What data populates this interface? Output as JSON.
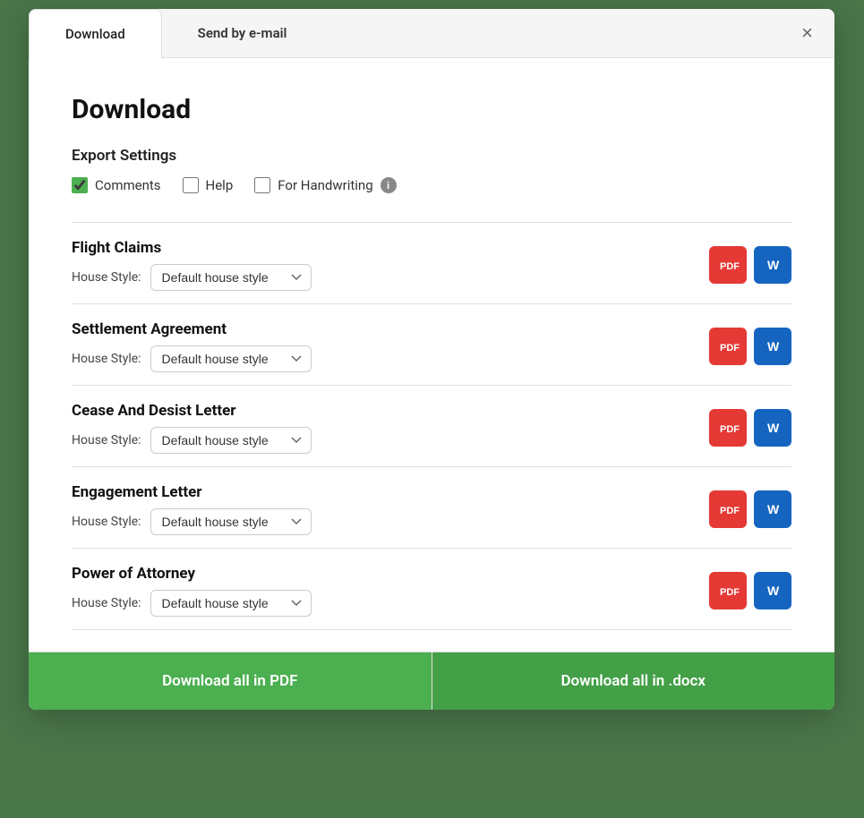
{
  "modal": {
    "tabs": [
      {
        "id": "download",
        "label": "Download",
        "active": true
      },
      {
        "id": "send-email",
        "label": "Send by e-mail",
        "active": false
      }
    ],
    "close_label": "×",
    "title": "Download",
    "export_settings_label": "Export Settings",
    "checkboxes": [
      {
        "id": "comments",
        "label": "Comments",
        "checked": true
      },
      {
        "id": "help",
        "label": "Help",
        "checked": false
      },
      {
        "id": "handwriting",
        "label": "For Handwriting",
        "checked": false,
        "has_info": true
      }
    ],
    "documents": [
      {
        "name": "Flight Claims",
        "house_style": "Default house style"
      },
      {
        "name": "Settlement Agreement",
        "house_style": "Default house style"
      },
      {
        "name": "Cease And Desist Letter",
        "house_style": "Default house style"
      },
      {
        "name": "Engagement Letter",
        "house_style": "Default house style"
      },
      {
        "name": "Power of Attorney",
        "house_style": "Default house style"
      }
    ],
    "house_style_label": "House Style:",
    "house_style_options": [
      "Default house style"
    ],
    "pdf_label": "PDF",
    "word_label": "W",
    "footer": {
      "download_pdf_label": "Download all in PDF",
      "download_docx_label": "Download all in .docx"
    },
    "info_icon_label": "i",
    "colors": {
      "pdf_red": "#e53935",
      "word_blue": "#1565c0",
      "green": "#4caf50"
    }
  }
}
